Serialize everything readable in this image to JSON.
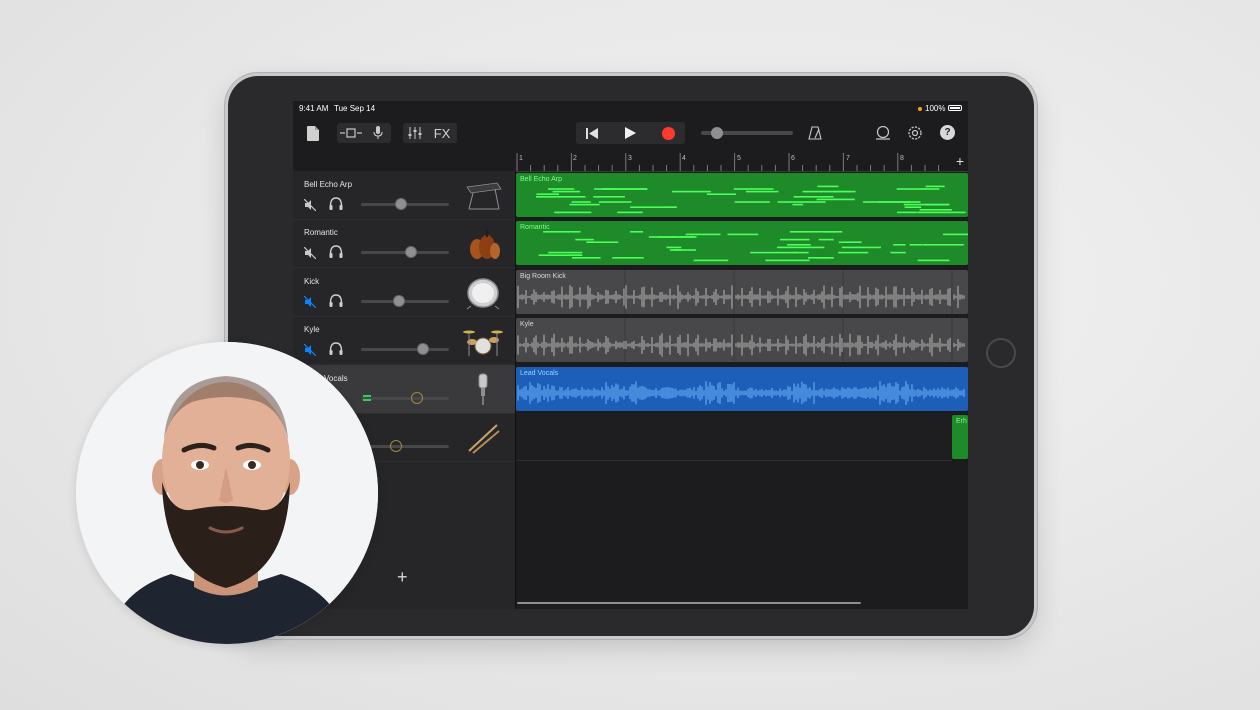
{
  "status_bar": {
    "time": "9:41 AM",
    "date": "Tue Sep 14",
    "battery": "100%"
  },
  "toolbar": {
    "fx_label": "FX",
    "help_label": "?"
  },
  "ruler": {
    "bars": [
      "1",
      "2",
      "3",
      "4",
      "5",
      "6",
      "7",
      "8"
    ],
    "add_label": "+"
  },
  "tracks": [
    {
      "name": "Bell Echo Arp",
      "volume": 0.45,
      "muted": false,
      "instrument_icon": "keyboard-icon"
    },
    {
      "name": "Romantic",
      "volume": 0.57,
      "muted": false,
      "instrument_icon": "strings-icon"
    },
    {
      "name": "Kick",
      "volume": 0.43,
      "muted": true,
      "instrument_icon": "kick-drum-icon"
    },
    {
      "name": "Kyle",
      "volume": 0.7,
      "muted": true,
      "instrument_icon": "drum-kit-icon"
    },
    {
      "name": "Lead Vocals",
      "volume": 0.64,
      "muted": false,
      "instrument_icon": "microphone-icon"
    },
    {
      "name": "",
      "volume": 0.4,
      "muted": false,
      "instrument_icon": "drumsticks-icon"
    }
  ],
  "regions": [
    {
      "label": "Bell Echo Arp",
      "kind": "midi",
      "color": "#1f8a2a"
    },
    {
      "label": "Romantic",
      "kind": "midi",
      "color": "#1f8a2a"
    },
    {
      "label": "Big Room Kick",
      "kind": "audio",
      "color": "#48484a"
    },
    {
      "label": "Kyle",
      "kind": "audio",
      "color": "#48484a"
    },
    {
      "label": "Lead Vocals",
      "kind": "audio",
      "color": "#1d5fb8"
    },
    {
      "label": "Erh",
      "kind": "midi",
      "color": "#1f8a2a"
    }
  ],
  "add_track_label": "+",
  "colors": {
    "record": "#ff3b30",
    "midi_note": "#4cff5a",
    "vocal_wave": "#6fb6ff",
    "mute_active": "#0a84ff"
  }
}
